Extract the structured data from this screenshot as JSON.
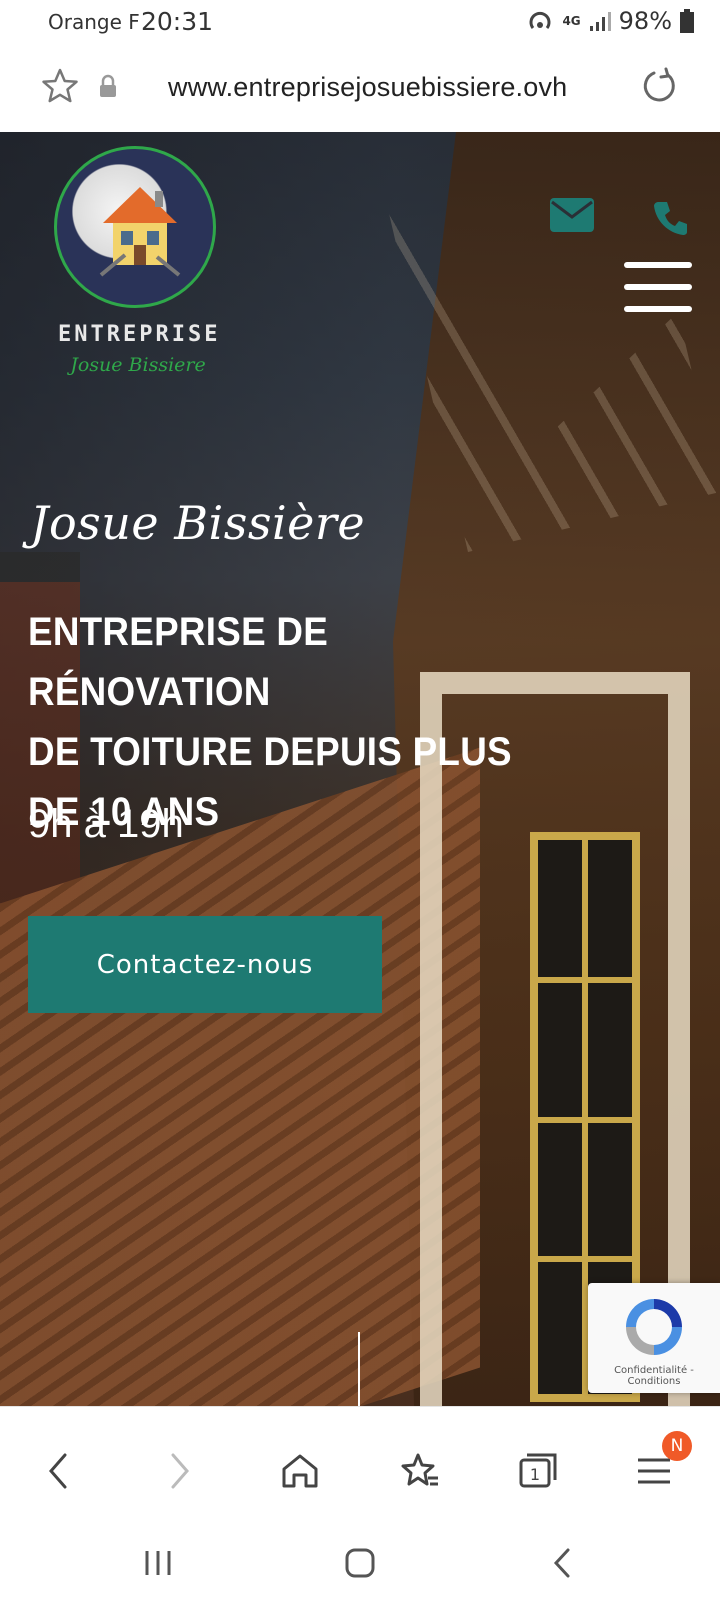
{
  "status_bar": {
    "carrier": "Orange F",
    "time": "20:31",
    "network": "4G",
    "battery": "98%"
  },
  "address_bar": {
    "url": "www.entreprisejosuebissiere.ovh"
  },
  "header": {
    "logo_title": "ENTREPRISE",
    "logo_subtitle": "Josue Bissiere"
  },
  "hero": {
    "script_title": "Josue Bissière",
    "title_lines": [
      "ENTREPRISE DE RÉNOVATION",
      "DE TOITURE DEPUIS PLUS",
      "DE 10 ANS"
    ],
    "hours": "9h à 19h",
    "cta_label": "Contactez-nous"
  },
  "recaptcha": {
    "text": "Confidentialité - Conditions"
  },
  "browser_toolbar": {
    "tabs_count": "1",
    "menu_badge": "N"
  },
  "colors": {
    "accent": "#1e7a72",
    "logo_green": "#2fa84a",
    "badge": "#f05a28"
  }
}
